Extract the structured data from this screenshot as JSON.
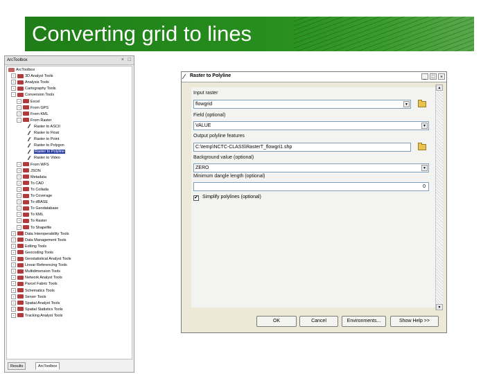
{
  "slide": {
    "title": "Converting grid to lines"
  },
  "toolbox": {
    "header": "ArcToolbox",
    "header_controls": [
      "×",
      "□"
    ],
    "items": [
      {
        "label": "ArcToolbox",
        "level": 0,
        "exp": "",
        "icon": "root"
      },
      {
        "label": "3D Analyst Tools",
        "level": 1,
        "exp": "+",
        "icon": "box"
      },
      {
        "label": "Analysis Tools",
        "level": 1,
        "exp": "+",
        "icon": "box"
      },
      {
        "label": "Cartography Tools",
        "level": 1,
        "exp": "+",
        "icon": "box"
      },
      {
        "label": "Conversion Tools",
        "level": 1,
        "exp": "−",
        "icon": "box"
      },
      {
        "label": "Excel",
        "level": 2,
        "exp": "+",
        "icon": "box"
      },
      {
        "label": "From GPS",
        "level": 2,
        "exp": "+",
        "icon": "box"
      },
      {
        "label": "From KML",
        "level": 2,
        "exp": "+",
        "icon": "box"
      },
      {
        "label": "From Raster",
        "level": 2,
        "exp": "−",
        "icon": "box"
      },
      {
        "label": "Raster to ASCII",
        "level": 3,
        "exp": "",
        "icon": "tool"
      },
      {
        "label": "Raster to Float",
        "level": 3,
        "exp": "",
        "icon": "tool"
      },
      {
        "label": "Raster to Point",
        "level": 3,
        "exp": "",
        "icon": "tool"
      },
      {
        "label": "Raster to Polygon",
        "level": 3,
        "exp": "",
        "icon": "tool"
      },
      {
        "label": "Raster to Polyline",
        "level": 3,
        "exp": "",
        "icon": "tool",
        "selected": true
      },
      {
        "label": "Raster to Video",
        "level": 3,
        "exp": "",
        "icon": "tool"
      },
      {
        "label": "From WFS",
        "level": 2,
        "exp": "+",
        "icon": "box"
      },
      {
        "label": "JSON",
        "level": 2,
        "exp": "+",
        "icon": "box"
      },
      {
        "label": "Metadata",
        "level": 2,
        "exp": "+",
        "icon": "box"
      },
      {
        "label": "To CAD",
        "level": 2,
        "exp": "+",
        "icon": "box"
      },
      {
        "label": "To Collada",
        "level": 2,
        "exp": "+",
        "icon": "box"
      },
      {
        "label": "To Coverage",
        "level": 2,
        "exp": "+",
        "icon": "box"
      },
      {
        "label": "To dBASE",
        "level": 2,
        "exp": "+",
        "icon": "box"
      },
      {
        "label": "To Geodatabase",
        "level": 2,
        "exp": "+",
        "icon": "box"
      },
      {
        "label": "To KML",
        "level": 2,
        "exp": "+",
        "icon": "box"
      },
      {
        "label": "To Raster",
        "level": 2,
        "exp": "+",
        "icon": "box"
      },
      {
        "label": "To Shapefile",
        "level": 2,
        "exp": "+",
        "icon": "box"
      },
      {
        "label": "Data Interoperability Tools",
        "level": 1,
        "exp": "+",
        "icon": "box"
      },
      {
        "label": "Data Management Tools",
        "level": 1,
        "exp": "+",
        "icon": "box"
      },
      {
        "label": "Editing Tools",
        "level": 1,
        "exp": "+",
        "icon": "box"
      },
      {
        "label": "Geocoding Tools",
        "level": 1,
        "exp": "+",
        "icon": "box"
      },
      {
        "label": "Geostatistical Analyst Tools",
        "level": 1,
        "exp": "+",
        "icon": "box"
      },
      {
        "label": "Linear Referencing Tools",
        "level": 1,
        "exp": "+",
        "icon": "box"
      },
      {
        "label": "Multidimension Tools",
        "level": 1,
        "exp": "+",
        "icon": "box"
      },
      {
        "label": "Network Analyst Tools",
        "level": 1,
        "exp": "+",
        "icon": "box"
      },
      {
        "label": "Parcel Fabric Tools",
        "level": 1,
        "exp": "+",
        "icon": "box"
      },
      {
        "label": "Schematics Tools",
        "level": 1,
        "exp": "+",
        "icon": "box"
      },
      {
        "label": "Server Tools",
        "level": 1,
        "exp": "+",
        "icon": "box"
      },
      {
        "label": "Spatial Analyst Tools",
        "level": 1,
        "exp": "+",
        "icon": "box"
      },
      {
        "label": "Spatial Statistics Tools",
        "level": 1,
        "exp": "+",
        "icon": "box"
      },
      {
        "label": "Tracking Analyst Tools",
        "level": 1,
        "exp": "+",
        "icon": "box"
      }
    ],
    "tabs": [
      "Results",
      "ArcToolbox"
    ]
  },
  "dialog": {
    "title": "Raster to Polyline",
    "window_buttons": [
      "_",
      "□",
      "×"
    ],
    "fields": {
      "input_raster": {
        "label": "Input raster",
        "value": "flowgrid"
      },
      "field": {
        "label": "Field (optional)",
        "value": "VALUE"
      },
      "output": {
        "label": "Output polyline features",
        "value": "C:\\temp\\NCTC-CLASS\\RasterT_flowgri1.shp"
      },
      "background": {
        "label": "Background value (optional)",
        "value": "ZERO"
      },
      "dangle": {
        "label": "Minimum dangle length (optional)",
        "value": "0"
      }
    },
    "simplify": {
      "label": "Simplify polylines (optional)",
      "checked": true,
      "mark": "✔"
    },
    "dropdown_arrow": "▼",
    "scroll_up": "▲",
    "scroll_down": "▼",
    "buttons": {
      "ok": "OK",
      "cancel": "Cancel",
      "environments": "Environments...",
      "show_help": "Show Help >>"
    }
  }
}
